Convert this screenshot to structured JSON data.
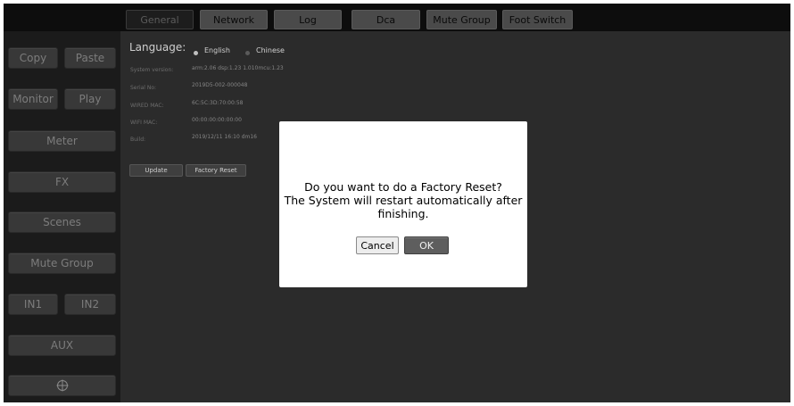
{
  "tabs": [
    {
      "label": "General",
      "active": true
    },
    {
      "label": "Network",
      "active": false
    },
    {
      "label": "Log",
      "active": false
    },
    {
      "label": "Dca",
      "active": false
    },
    {
      "label": "Mute Group",
      "active": false
    },
    {
      "label": "Foot Switch",
      "active": false
    }
  ],
  "sidebar": {
    "copy": "Copy",
    "paste": "Paste",
    "monitor": "Monitor",
    "play": "Play",
    "meter": "Meter",
    "fx": "FX",
    "scenes": "Scenes",
    "mute_group": "Mute Group",
    "in1": "IN1",
    "in2": "IN2",
    "aux": "AUX",
    "bottom_icon": "crosshair-icon"
  },
  "general": {
    "language_label": "Language:",
    "language_options": [
      "English",
      "Chinese"
    ],
    "language_selected": "English",
    "info": [
      {
        "label": "System version:",
        "value": "arm:2.06 dsp:1.23 1.010mcu:1.23"
      },
      {
        "label": "Serial No:",
        "value": "2019D5-002-000048"
      },
      {
        "label": "WIRED MAC:",
        "value": "6C:5C:3D:70:00:58"
      },
      {
        "label": "WIFI MAC:",
        "value": "00:00:00:00:00:00"
      },
      {
        "label": "Build:",
        "value": "2019/12/11 16:10 dm16"
      }
    ],
    "update_button": "Update",
    "factory_reset_button": "Factory Reset"
  },
  "dialog": {
    "line1": "Do you want to do a Factory Reset?",
    "line2": "The System will restart automatically after",
    "line3": "finishing.",
    "cancel": "Cancel",
    "ok": "OK"
  }
}
